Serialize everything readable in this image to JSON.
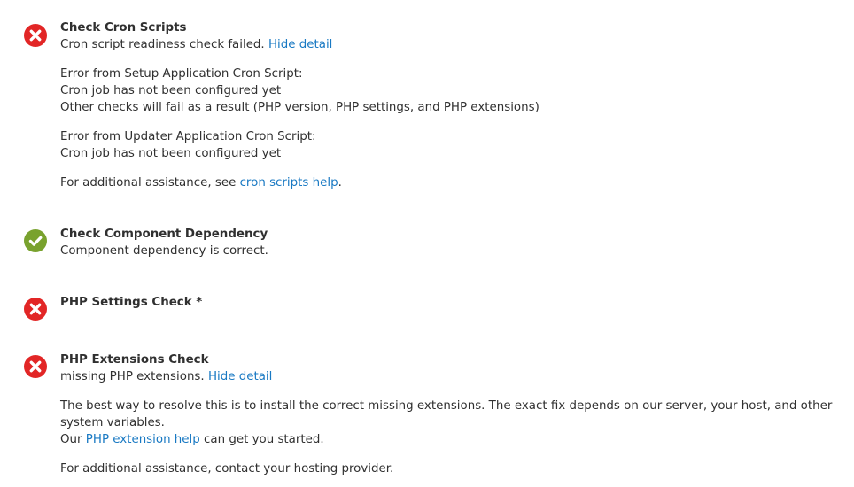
{
  "checks": {
    "cron": {
      "status": "error",
      "title": "Check Cron Scripts",
      "message": "Cron script readiness check failed.",
      "toggle_label": "Hide detail",
      "setup_error_heading": "Error from Setup Application Cron Script:",
      "setup_error_line1": "Cron job has not been configured yet",
      "setup_error_line2": "Other checks will fail as a result (PHP version, PHP settings, and PHP extensions)",
      "updater_error_heading": "Error from Updater Application Cron Script:",
      "updater_error_line1": "Cron job has not been configured yet",
      "assistance_prefix": "For additional assistance, see ",
      "assistance_link": "cron scripts help",
      "assistance_suffix": "."
    },
    "dependency": {
      "status": "success",
      "title": "Check Component Dependency",
      "message": "Component dependency is correct."
    },
    "php_settings": {
      "status": "error",
      "title": "PHP Settings Check *"
    },
    "php_extensions": {
      "status": "error",
      "title": "PHP Extensions Check",
      "message": "missing PHP extensions.",
      "toggle_label": "Hide detail",
      "resolve_text": "The best way to resolve this is to install the correct missing extensions. The exact fix depends on our server, your host, and other system variables.",
      "help_prefix": "Our ",
      "help_link": "PHP extension help",
      "help_suffix": " can get you started.",
      "assistance": "For additional assistance, contact your hosting provider."
    }
  },
  "colors": {
    "error": "#e22626",
    "success": "#79a22e",
    "link": "#1979c3",
    "text": "#303030"
  },
  "icons": {
    "error": "error-x-icon",
    "success": "success-check-icon"
  }
}
